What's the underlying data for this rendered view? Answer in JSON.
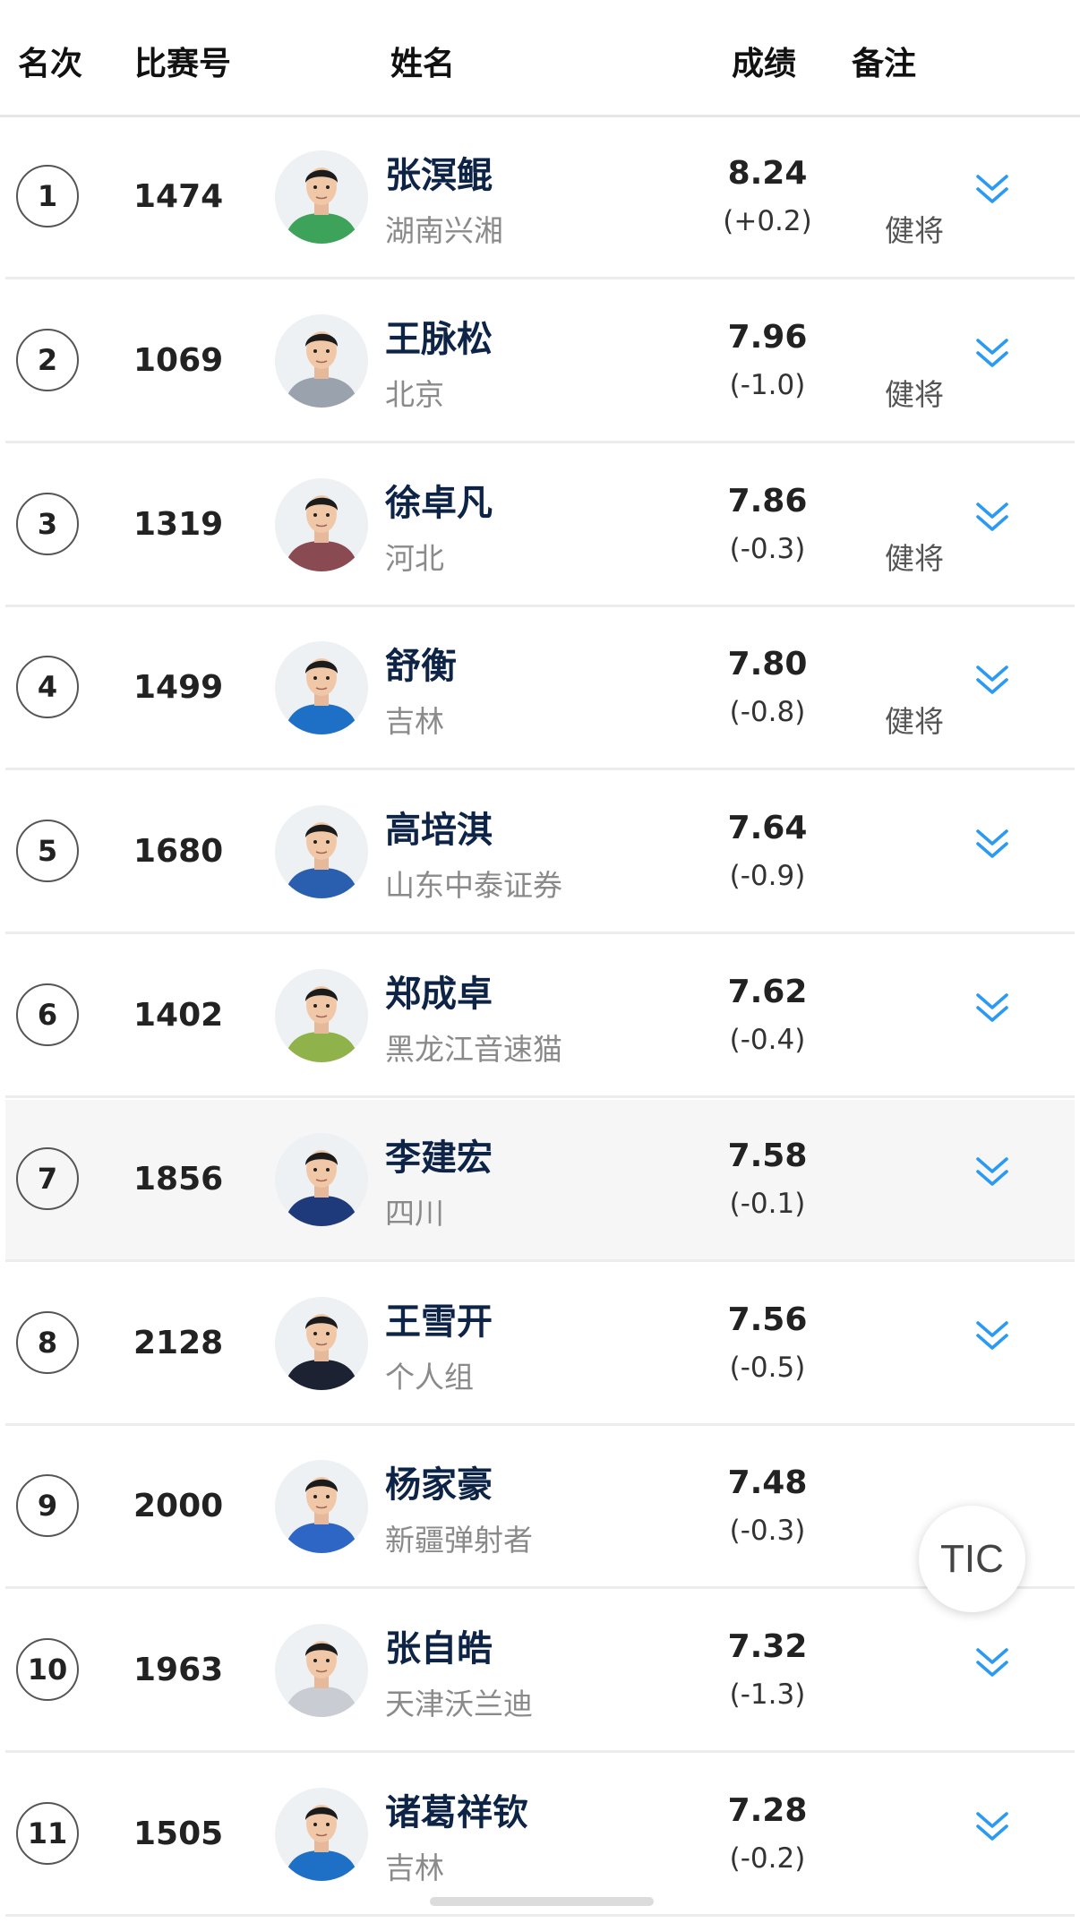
{
  "header": {
    "rank": "名次",
    "bib": "比赛号",
    "name": "姓名",
    "result": "成绩",
    "remark": "备注"
  },
  "rows": [
    {
      "rank": "1",
      "bib": "1474",
      "name": "张溟鲲",
      "team": "湖南兴湘",
      "result": "8.24",
      "wind": "(+0.2)",
      "remark": "健将",
      "jersey": "#3da25a",
      "shirt": "#3da25a"
    },
    {
      "rank": "2",
      "bib": "1069",
      "name": "王脉松",
      "team": "北京",
      "result": "7.96",
      "wind": "(-1.0)",
      "remark": "健将",
      "jersey": "#9aa2ad",
      "shirt": "#9aa2ad"
    },
    {
      "rank": "3",
      "bib": "1319",
      "name": "徐卓凡",
      "team": "河北",
      "result": "7.86",
      "wind": "(-0.3)",
      "remark": "健将",
      "jersey": "#8a4a52",
      "shirt": "#8a4a52"
    },
    {
      "rank": "4",
      "bib": "1499",
      "name": "舒衡",
      "team": "吉林",
      "result": "7.80",
      "wind": "(-0.8)",
      "remark": "健将",
      "jersey": "#1e6fc6",
      "shirt": "#1e6fc6"
    },
    {
      "rank": "5",
      "bib": "1680",
      "name": "高培淇",
      "team": "山东中泰证券",
      "result": "7.64",
      "wind": "(-0.9)",
      "remark": "",
      "jersey": "#2a5fb0",
      "shirt": "#2a5fb0"
    },
    {
      "rank": "6",
      "bib": "1402",
      "name": "郑成卓",
      "team": "黑龙江音速猫",
      "result": "7.62",
      "wind": "(-0.4)",
      "remark": "",
      "jersey": "#8fb34a",
      "shirt": "#8fb34a"
    },
    {
      "rank": "7",
      "bib": "1856",
      "name": "李建宏",
      "team": "四川",
      "result": "7.58",
      "wind": "(-0.1)",
      "remark": "",
      "jersey": "#1f3a7a",
      "shirt": "#1f3a7a"
    },
    {
      "rank": "8",
      "bib": "2128",
      "name": "王雪开",
      "team": "个人组",
      "result": "7.56",
      "wind": "(-0.5)",
      "remark": "",
      "jersey": "#1d2233",
      "shirt": "#1d2233"
    },
    {
      "rank": "9",
      "bib": "2000",
      "name": "杨家豪",
      "team": "新疆弹射者",
      "result": "7.48",
      "wind": "(-0.3)",
      "remark": "",
      "jersey": "#2d66c4",
      "shirt": "#2d66c4"
    },
    {
      "rank": "10",
      "bib": "1963",
      "name": "张自皓",
      "team": "天津沃兰迪",
      "result": "7.32",
      "wind": "(-1.3)",
      "remark": "",
      "jersey": "#c9cdd3",
      "shirt": "#c9cdd3"
    },
    {
      "rank": "11",
      "bib": "1505",
      "name": "诸葛祥钦",
      "team": "吉林",
      "result": "7.28",
      "wind": "(-0.2)",
      "remark": "",
      "jersey": "#1e6fc6",
      "shirt": "#1e6fc6"
    }
  ],
  "floating_button": {
    "label": "TIC"
  },
  "colors": {
    "accent_chevron": "#2b9af3",
    "name_text": "#0e2447"
  }
}
